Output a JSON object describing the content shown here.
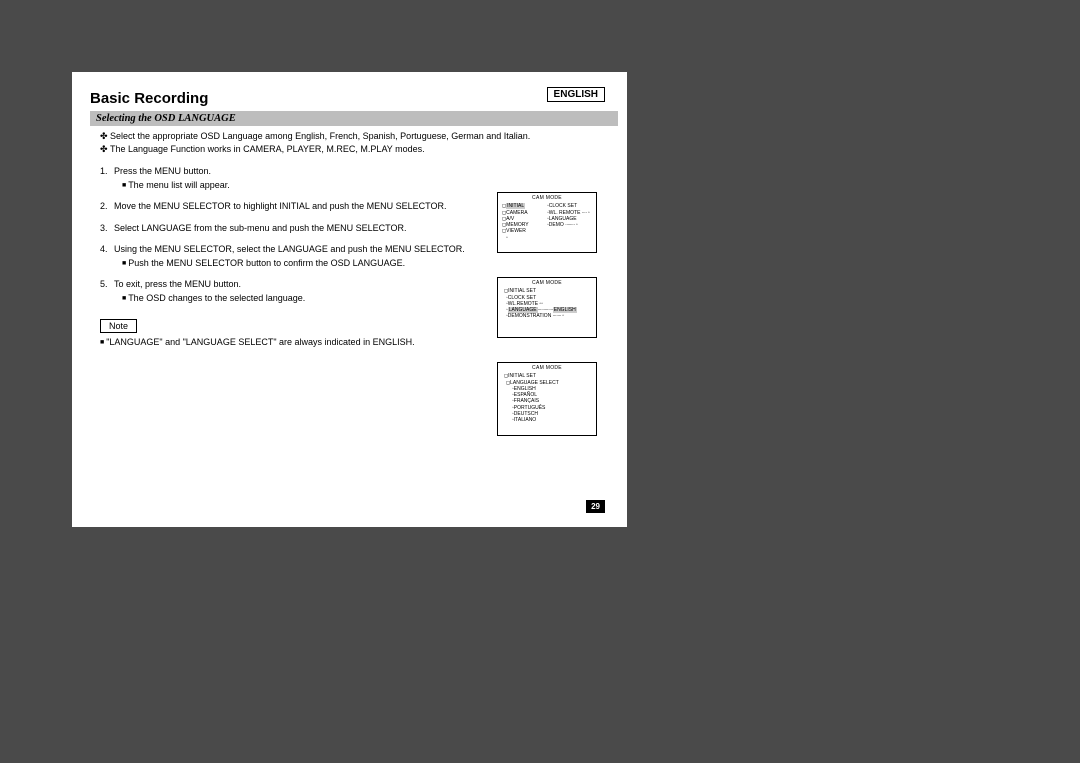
{
  "header": {
    "language_badge": "ENGLISH",
    "title": "Basic Recording",
    "subtitle": "Selecting the OSD LANGUAGE"
  },
  "intro": {
    "line1": "Select the appropriate OSD Language among English, French, Spanish, Portuguese, German and Italian.",
    "line2": "The Language Function works in CAMERA, PLAYER, M.REC, M.PLAY modes."
  },
  "steps": [
    {
      "num": "1.",
      "text": "Press the MENU button.",
      "sub": "The menu list will appear."
    },
    {
      "num": "2.",
      "text": "Move the MENU SELECTOR to highlight INITIAL and push the MENU SELECTOR.",
      "sub": null
    },
    {
      "num": "3.",
      "text": "Select LANGUAGE from the sub-menu and push the MENU SELECTOR.",
      "sub": null
    },
    {
      "num": "4.",
      "text": "Using the MENU SELECTOR, select the LANGUAGE and push the MENU SELECTOR.",
      "sub": "Push the MENU SELECTOR button to confirm the OSD LANGUAGE."
    },
    {
      "num": "5.",
      "text": "To exit, press the MENU button.",
      "sub": "The OSD changes to the selected language."
    }
  ],
  "note": {
    "label": "Note",
    "text": "\"LANGUAGE\" and \"LANGUAGE SELECT\" are always indicated in ENGLISH."
  },
  "osd": {
    "title": "CAM MODE",
    "panel1": {
      "initial": "INITIAL",
      "clock": "CLOCK SET",
      "camera": "CAMERA",
      "wlremote": "WL. REMOTE",
      "av": "A/V",
      "language": "LANGUAGE",
      "memory": "MEMORY",
      "demo": "DEMO",
      "viewer": "VIEWER"
    },
    "panel2": {
      "set": "INITIAL SET",
      "clock": "CLOCK SET",
      "wlremote": "WL.REMOTE",
      "language": "LANGUAGE",
      "english": "ENGLISH",
      "demo": "DEMONSTRATION"
    },
    "panel3": {
      "set": "INITIAL SET",
      "langsel": "LANGUAGE SELECT",
      "options": [
        "ENGLISH",
        "ESPAÑOL",
        "FRANÇAIS",
        "PORTUGUÊS",
        "DEUTSCH",
        "ITALIANO"
      ]
    }
  },
  "page_number": "29"
}
